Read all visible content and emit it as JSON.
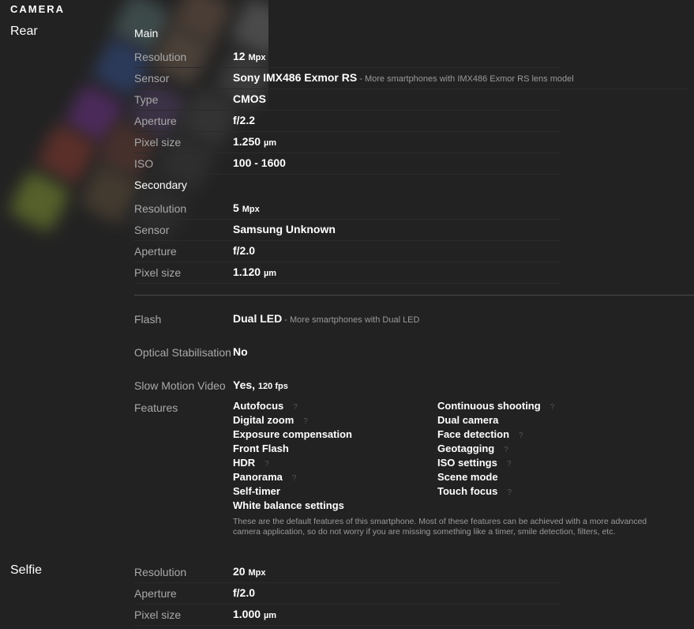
{
  "section_title": "CAMERA",
  "rear": {
    "label": "Rear",
    "main": {
      "title": "Main",
      "rows": [
        {
          "label": "Resolution",
          "value": "12",
          "unit": "Mpx"
        },
        {
          "label": "Sensor",
          "value": "Sony IMX486 Exmor RS",
          "hint": " - More smartphones with IMX486 Exmor RS lens model"
        },
        {
          "label": "Type",
          "value": "CMOS"
        },
        {
          "label": "Aperture",
          "value": "f/2.2"
        },
        {
          "label": "Pixel size",
          "value": "1.250",
          "unit": "µm"
        },
        {
          "label": "ISO",
          "value": "100 - 1600"
        }
      ]
    },
    "secondary": {
      "title": "Secondary",
      "rows": [
        {
          "label": "Resolution",
          "value": "5",
          "unit": "Mpx"
        },
        {
          "label": "Sensor",
          "value": "Samsung Unknown"
        },
        {
          "label": "Aperture",
          "value": "f/2.0"
        },
        {
          "label": "Pixel size",
          "value": "1.120",
          "unit": "µm"
        }
      ]
    },
    "flash": {
      "label": "Flash",
      "value": "Dual LED",
      "hint": " - More smartphones with Dual LED"
    },
    "stabilisation": {
      "label": "Optical Stabilisation",
      "value": "No"
    },
    "slowmo": {
      "label": "Slow Motion Video",
      "value": "Yes,",
      "unit": "120 fps"
    },
    "features": {
      "label": "Features",
      "left": [
        {
          "name": "Autofocus",
          "help": "?"
        },
        {
          "name": "Digital zoom",
          "help": "?"
        },
        {
          "name": "Exposure compensation",
          "help": ""
        },
        {
          "name": "Front Flash",
          "help": ""
        },
        {
          "name": "HDR",
          "help": "?"
        },
        {
          "name": "Panorama",
          "help": "?"
        },
        {
          "name": "Self-timer",
          "help": ""
        },
        {
          "name": "White balance settings",
          "help": ""
        }
      ],
      "right": [
        {
          "name": "Continuous shooting",
          "help": "?"
        },
        {
          "name": "Dual camera",
          "help": ""
        },
        {
          "name": "Face detection",
          "help": "?"
        },
        {
          "name": "Geotagging",
          "help": "?"
        },
        {
          "name": "ISO settings",
          "help": "?"
        },
        {
          "name": "Scene mode",
          "help": ""
        },
        {
          "name": "Touch focus",
          "help": "?"
        }
      ],
      "note": "These are the default features of this smartphone. Most of these features can be achieved with a more advanced camera application, so do not worry if you are missing something like a timer, smile detection, filters, etc."
    }
  },
  "selfie": {
    "label": "Selfie",
    "rows": [
      {
        "label": "Resolution",
        "value": "20",
        "unit": "Mpx"
      },
      {
        "label": "Aperture",
        "value": "f/2.0"
      },
      {
        "label": "Pixel size",
        "value": "1.000",
        "unit": "µm"
      }
    ]
  }
}
